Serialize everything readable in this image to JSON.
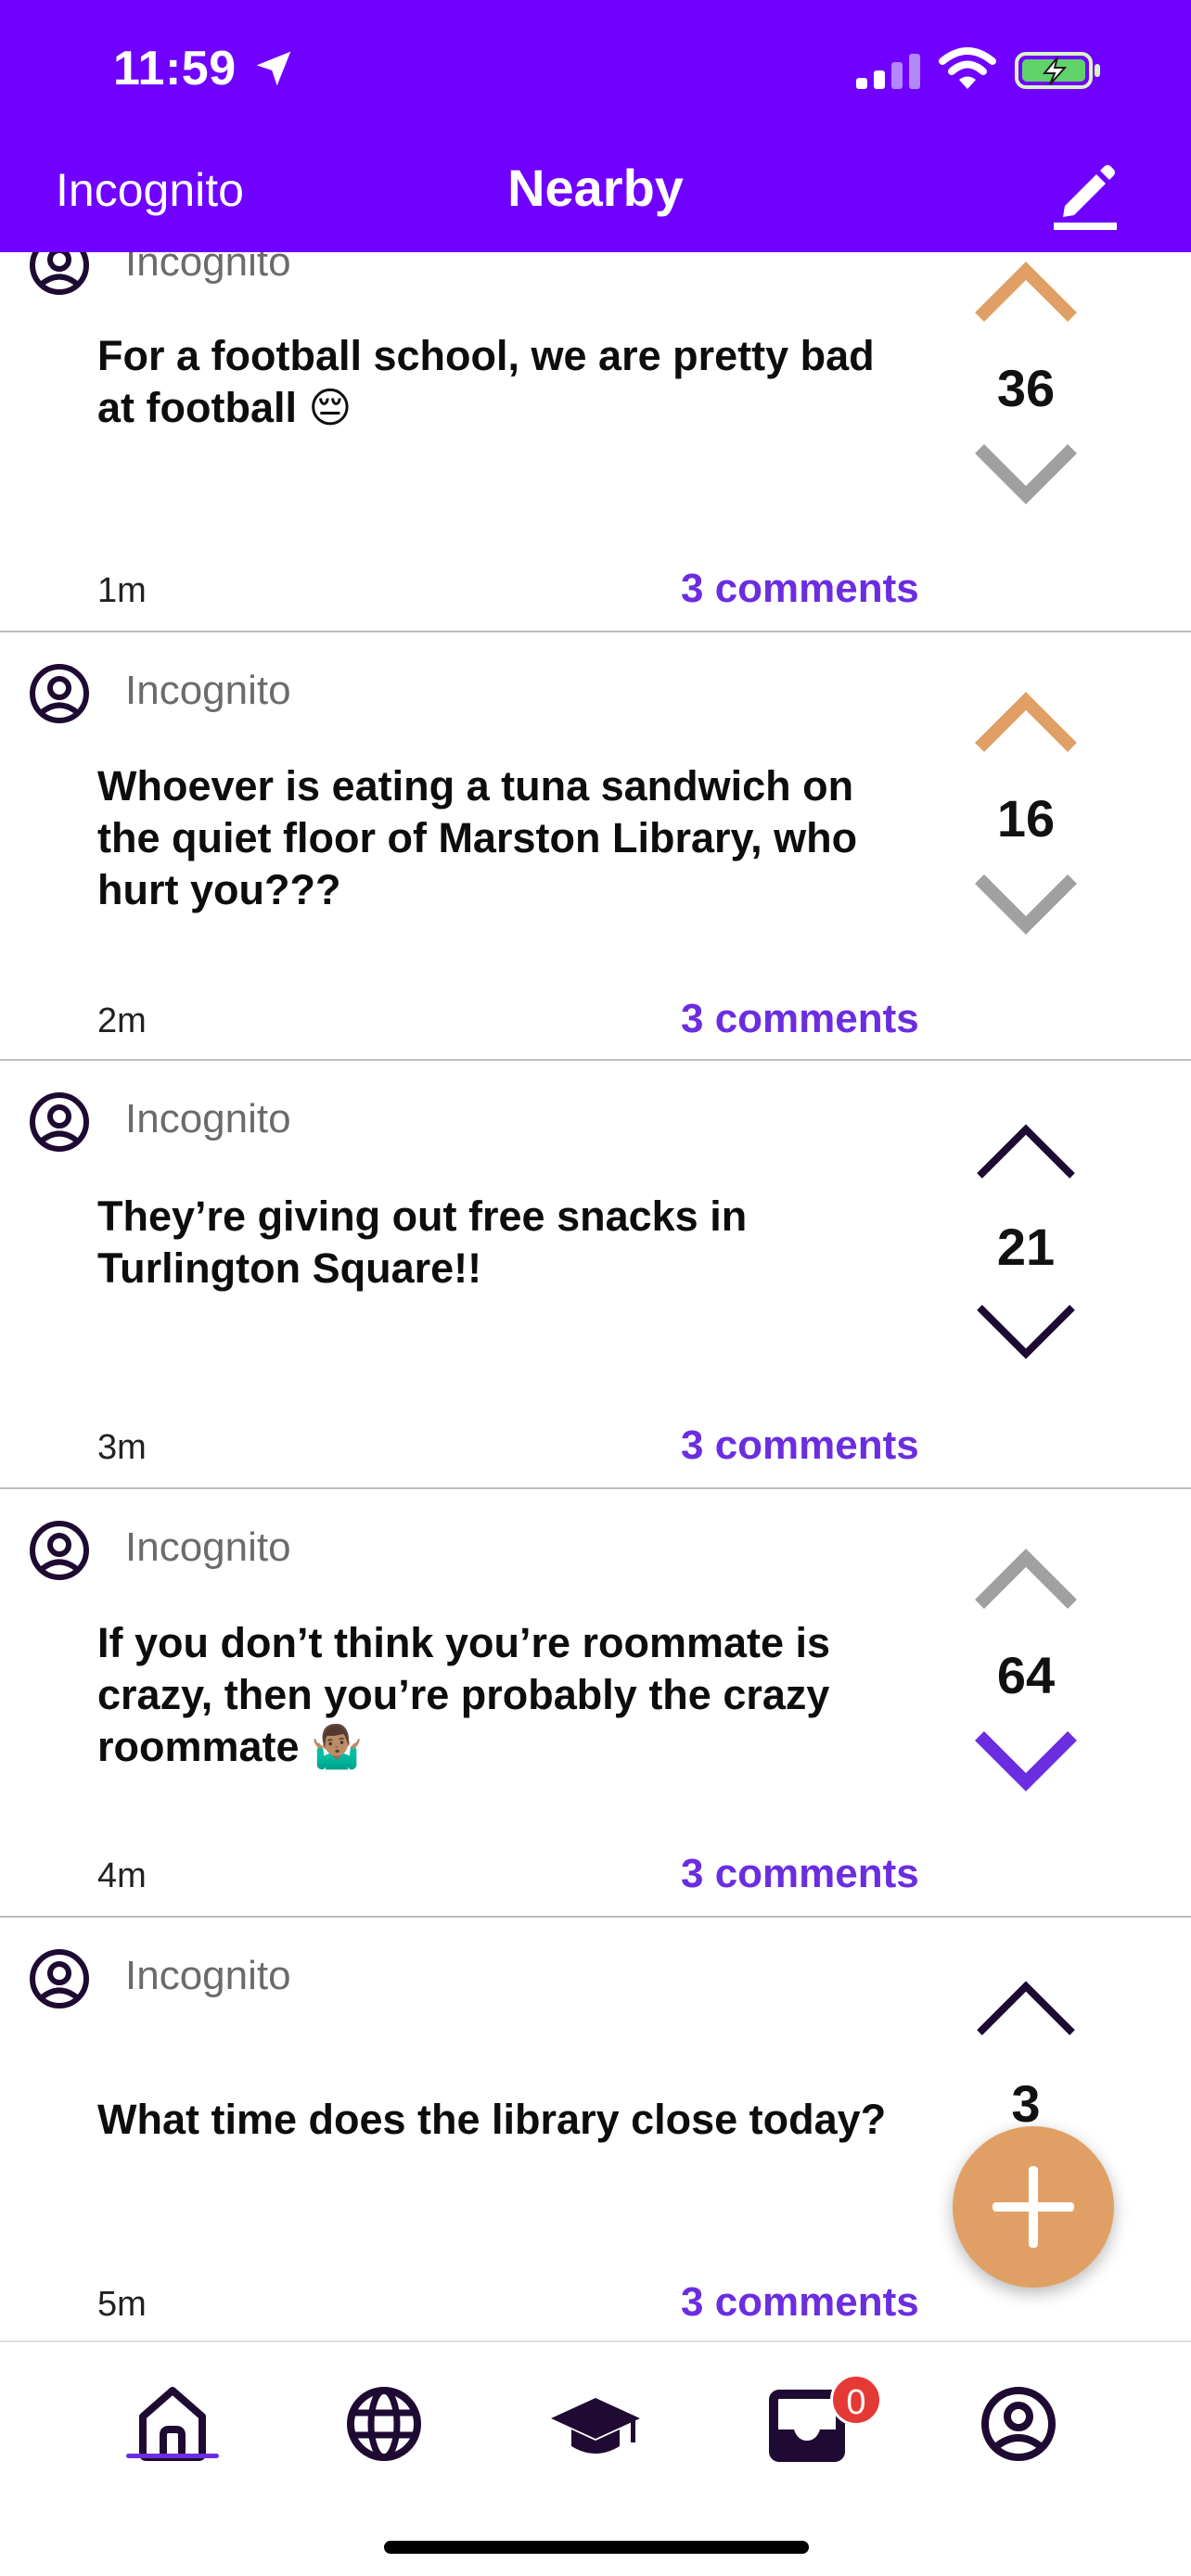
{
  "status_bar": {
    "time": "11:59",
    "icons": [
      "location-arrow-icon",
      "cellular-signal-icon",
      "wifi-icon",
      "battery-charging-icon"
    ]
  },
  "header": {
    "left_label": "Incognito",
    "title": "Nearby",
    "right_icon": "edit-pencil-icon"
  },
  "colors": {
    "brand": "#7000ff",
    "accent_orange": "#e0a065",
    "link_purple": "#6b2de0",
    "vote_gray": "#a0a0a0",
    "vote_dark": "#1e0a32",
    "badge_red": "#e53935"
  },
  "posts": [
    {
      "author": "Incognito",
      "text": "For a football school, we are pretty bad\nat football 😔",
      "age": "1m",
      "comments": "3 comments",
      "votes": "36",
      "vote_state": "upvoted"
    },
    {
      "author": "Incognito",
      "text": "Whoever is eating a tuna sandwich on\nthe quiet floor of Marston Library, who\nhurt you???",
      "age": "2m",
      "comments": "3 comments",
      "votes": "16",
      "vote_state": "upvoted"
    },
    {
      "author": "Incognito",
      "text": "They’re giving out free snacks in\nTurlington Square!!",
      "age": "3m",
      "comments": "3 comments",
      "votes": "21",
      "vote_state": "none"
    },
    {
      "author": "Incognito",
      "text": "If you don’t think you’re roommate is\ncrazy, then you’re probably the crazy\nroommate 🤷🏽‍♂️",
      "age": "4m",
      "comments": "3 comments",
      "votes": "64",
      "vote_state": "downvoted"
    },
    {
      "author": "Incognito",
      "text": "What time does the library close today?",
      "age": "5m",
      "comments": "3 comments",
      "votes": "3",
      "vote_state": "none"
    }
  ],
  "fab": {
    "icon": "plus-icon"
  },
  "tabbar": {
    "tabs": [
      "home-icon",
      "globe-icon",
      "graduation-cap-icon",
      "inbox-icon",
      "profile-icon"
    ],
    "active": "home-icon",
    "inbox_badge": "0"
  }
}
